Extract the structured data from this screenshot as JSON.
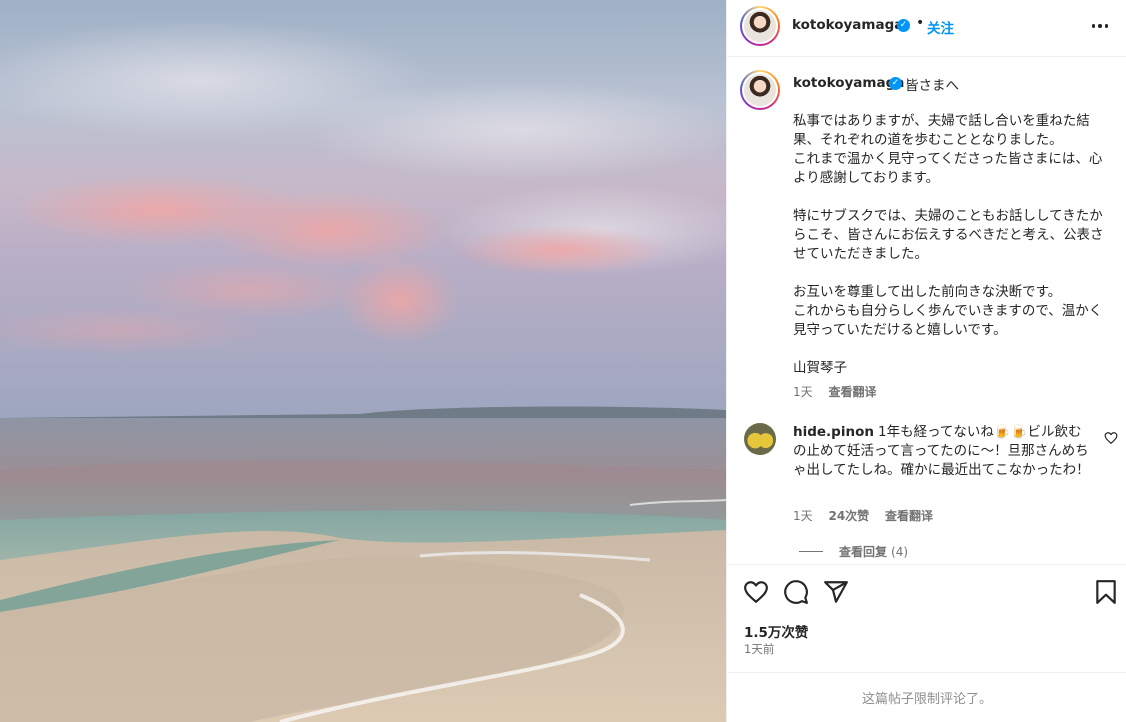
{
  "post": {
    "username": "kotokoyamaga",
    "follow_label": "关注",
    "separator": "•",
    "verified_mark": "✓"
  },
  "caption": {
    "username": "kotokoyamaga",
    "greeting": "皆さまへ",
    "body": "私事ではありますが、夫婦で話し合いを重ねた結果、それぞれの道を歩むこととなりました。\nこれまで温かく見守ってくださった皆さまには、心より感謝しております。\n\n特にサブスクでは、夫婦のこともお話ししてきたからこそ、皆さんにお伝えするべきだと考え、公表させていただきました。\n\nお互いを尊重して出した前向きな決断です。\nこれからも自分らしく歩んでいきますので、温かく見守っていただけると嬉しいです。\n\n山賀琴子",
    "time": "1天",
    "translate": "查看翻译"
  },
  "comment": {
    "username": "hide.pinon",
    "text": "1年も経ってないね🍺🍺ビル飲むの止めて妊活って言ってたのに〜！旦那さんめちゃ出してたしね。確かに最近出てこなかったわ！",
    "time": "1天",
    "likes": "24次赞",
    "translate": "查看翻译",
    "replies_label": "查看回复",
    "replies_count": "(4)"
  },
  "actions": {
    "likes": "1.5万次赞",
    "date": "1天前"
  },
  "footer": {
    "limited": "这篇帖子限制评论了。"
  },
  "colors": {
    "accent": "#0095f6",
    "text": "#262626",
    "muted": "#737373"
  }
}
